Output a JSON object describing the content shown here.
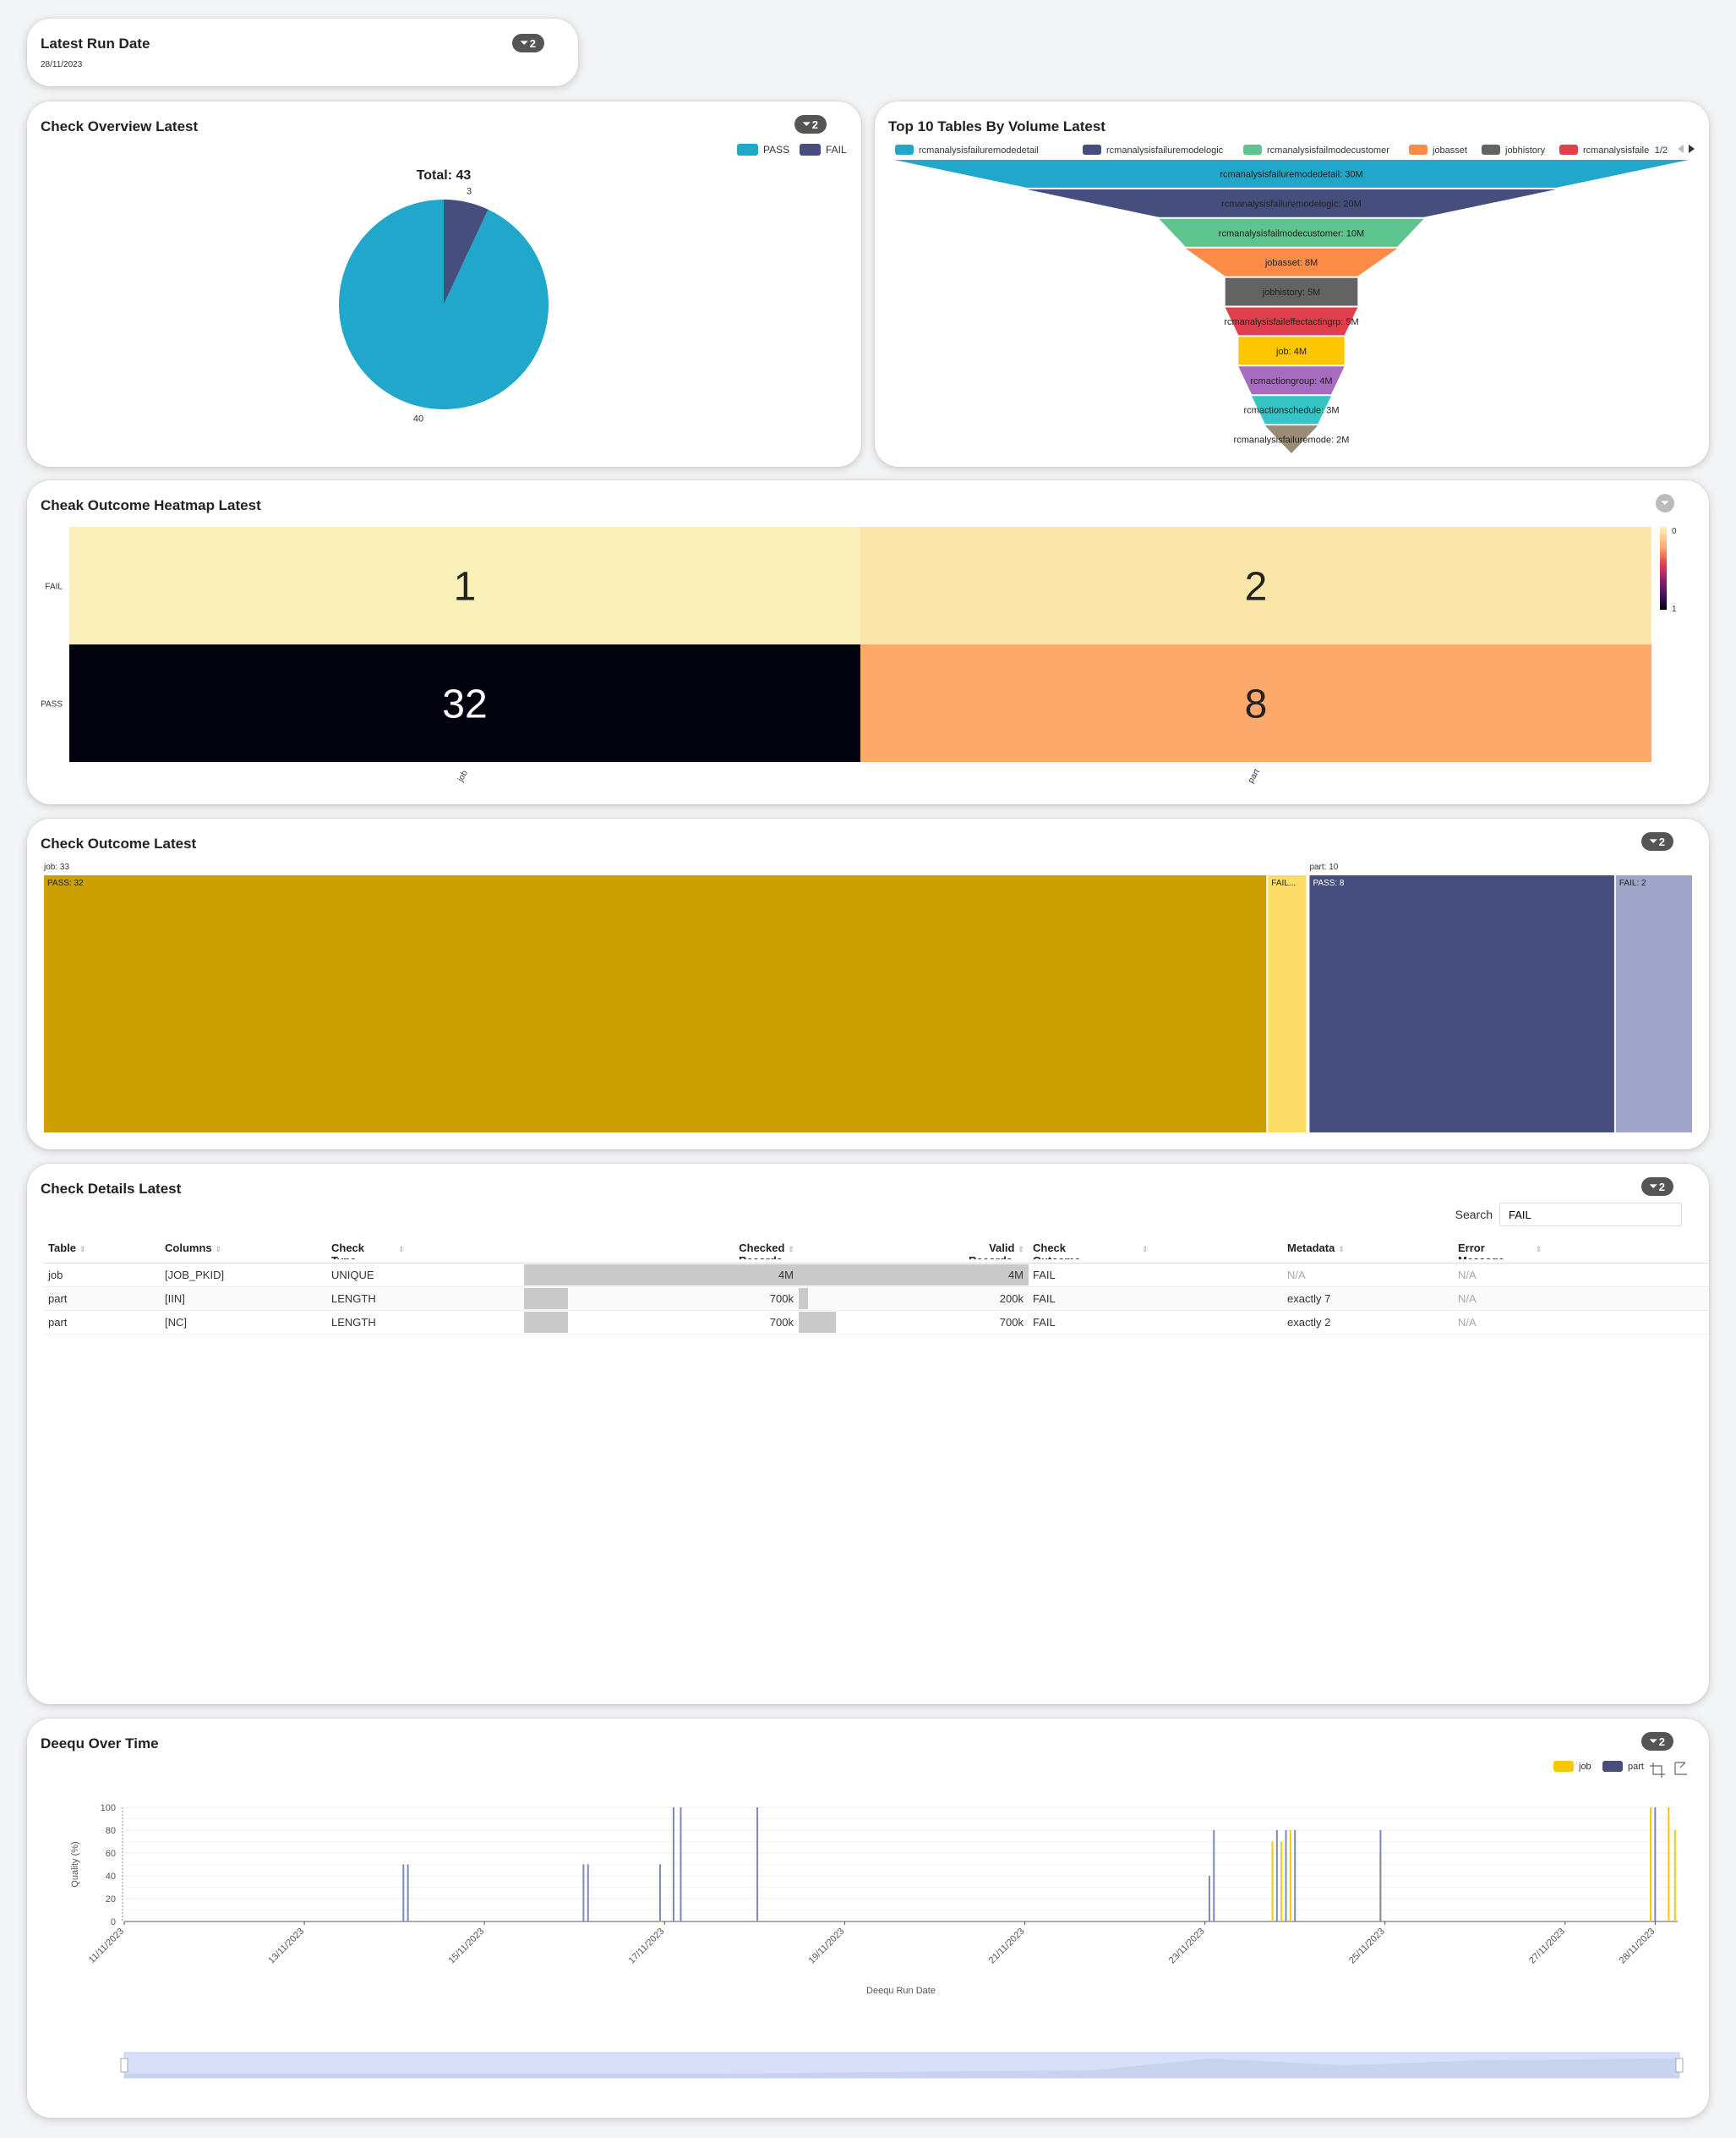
{
  "colors": {
    "pass": "#20a7c9",
    "fail": "#454e7c",
    "job": "#fcc700",
    "part": "#454e7c"
  },
  "latest_run": {
    "title": "Latest Run Date",
    "date": "28/11/2023",
    "filter_count": "2"
  },
  "overview": {
    "title": "Check Overview Latest",
    "filter_count": "2",
    "legend": [
      "PASS",
      "FAIL"
    ],
    "total_label": "Total: 43"
  },
  "funnel": {
    "title": "Top 10 Tables By Volume Latest",
    "legend": [
      "rcmanalysisfailuremodedetail",
      "rcmanalysisfailuremodelogic",
      "rcmanalysisfailmodecustomer",
      "jobasset",
      "jobhistory",
      "rcmanalysisfaile"
    ],
    "legend_page": "1/2"
  },
  "heatmap": {
    "title": "Cheak Outcome Heatmap Latest",
    "scale_max_label": "0",
    "scale_min_label": "1"
  },
  "treemap": {
    "title": "Check Outcome Latest",
    "filter_count": "2"
  },
  "details": {
    "title": "Check Details Latest",
    "filter_count": "2",
    "search_label": "Search",
    "search_value": "FAIL",
    "headers": [
      {
        "label": "Table",
        "sub": ""
      },
      {
        "label": "Columns",
        "sub": ""
      },
      {
        "label": "Check",
        "sub": "Type"
      },
      {
        "label": "Checked",
        "sub": "Records"
      },
      {
        "label": "Valid",
        "sub": "Records"
      },
      {
        "label": "Check",
        "sub": "Outcome"
      },
      {
        "label": "Metadata",
        "sub": ""
      },
      {
        "label": "Error",
        "sub": "Message"
      }
    ],
    "rows": [
      {
        "table": "job",
        "columns": "[JOB_PKID]",
        "type": "UNIQUE",
        "checked": "4M",
        "checked_frac": 1.0,
        "valid": "4M",
        "valid_frac": 1.0,
        "outcome": "FAIL",
        "metadata": "N/A",
        "error": "N/A"
      },
      {
        "table": "part",
        "columns": "[IIN]",
        "type": "LENGTH",
        "checked": "700k",
        "checked_frac": 0.16,
        "valid": "200k",
        "valid_frac": 0.04,
        "outcome": "FAIL",
        "metadata": "exactly 7",
        "error": "N/A"
      },
      {
        "table": "part",
        "columns": "[NC]",
        "type": "LENGTH",
        "checked": "700k",
        "checked_frac": 0.16,
        "valid": "700k",
        "valid_frac": 0.16,
        "outcome": "FAIL",
        "metadata": "exactly 2",
        "error": "N/A"
      }
    ]
  },
  "deequ": {
    "title": "Deequ Over Time",
    "filter_count": "2",
    "legend": [
      "job",
      "part"
    ]
  },
  "chart_data": [
    {
      "type": "pie",
      "title": "Total: 43",
      "categories": [
        "PASS",
        "FAIL"
      ],
      "values": [
        40,
        3
      ],
      "legend": "top-right"
    },
    {
      "type": "funnel",
      "categories": [
        "rcmanalysisfailuremodedetail",
        "rcmanalysisfailuremodelogic",
        "rcmanalysisfailmodecustomer",
        "jobasset",
        "jobhistory",
        "rcmanalysisfaileffectactingrp",
        "job",
        "rcmactiongroup",
        "rcmactionschedule",
        "rcmanalysisfailuremode"
      ],
      "values": [
        30,
        20,
        10,
        8,
        5,
        5,
        4,
        4,
        3,
        2
      ],
      "labels": [
        "rcmanalysisfailuremodedetail: 30M",
        "rcmanalysisfailuremodelogic: 20M",
        "rcmanalysisfailmodecustomer: 10M",
        "jobasset: 8M",
        "jobhistory: 5M",
        "rcmanalysisfaileffectactingrp: 5M",
        "job: 4M",
        "rcmactiongroup: 4M",
        "rcmactionschedule: 3M",
        "rcmanalysisfailuremode: 2M"
      ],
      "colors": [
        "#20a7c9",
        "#454e7c",
        "#5dc48f",
        "#fc8b47",
        "#636363",
        "#e0404e",
        "#fcc700",
        "#a76bc1",
        "#38c4c6",
        "#9c8b76"
      ],
      "legend": "top"
    },
    {
      "type": "heatmap",
      "x": [
        "job",
        "part"
      ],
      "y": [
        "FAIL",
        "PASS"
      ],
      "values": [
        [
          1,
          2
        ],
        [
          32,
          8
        ]
      ],
      "cell_colors": [
        [
          "#f9f0b9",
          "#f9e6a8"
        ],
        [
          "#03020f",
          "#fda96b"
        ]
      ]
    },
    {
      "type": "treemap",
      "groups": [
        {
          "name": "job",
          "label": "job: 33",
          "value": 33,
          "children": [
            {
              "name": "PASS",
              "label": "PASS: 32",
              "value": 32,
              "color": "#cca000"
            },
            {
              "name": "FAIL",
              "label": "FAIL...",
              "value": 1,
              "color": "#fddd67"
            }
          ]
        },
        {
          "name": "part",
          "label": "part: 10",
          "value": 10,
          "children": [
            {
              "name": "PASS",
              "label": "PASS: 8",
              "value": 8,
              "color": "#454e7c"
            },
            {
              "name": "FAIL",
              "label": "FAIL: 2",
              "value": 2,
              "color": "#9fa5c8"
            }
          ]
        }
      ]
    },
    {
      "type": "bar",
      "xlabel": "Deequ Run Date",
      "ylabel": "Quality (%)",
      "ylim": [
        0,
        100
      ],
      "yticks": [
        0,
        20,
        40,
        60,
        80,
        100
      ],
      "x_range": [
        "11/11/2023",
        "28/11/2023"
      ],
      "xticks": [
        "11/11/2023",
        "13/11/2023",
        "15/11/2023",
        "17/11/2023",
        "19/11/2023",
        "21/11/2023",
        "23/11/2023",
        "25/11/2023",
        "27/11/2023",
        "28/11/2023"
      ],
      "legend": "top-right",
      "series": [
        {
          "name": "job",
          "points": [
            {
              "day": 16.95,
              "value": 0
            },
            {
              "day": 17.1,
              "value": 20
            },
            {
              "day": 23.75,
              "value": 70
            },
            {
              "day": 23.85,
              "value": 70
            },
            {
              "day": 23.95,
              "value": 80
            },
            {
              "day": 24.95,
              "value": 60
            },
            {
              "day": 27.95,
              "value": 100
            },
            {
              "day": 28.15,
              "value": 100
            },
            {
              "day": 28.22,
              "value": 80
            }
          ]
        },
        {
          "name": "part",
          "points": [
            {
              "day": 14.1,
              "value": 50
            },
            {
              "day": 14.15,
              "value": 50
            },
            {
              "day": 16.1,
              "value": 50
            },
            {
              "day": 16.15,
              "value": 50
            },
            {
              "day": 16.95,
              "value": 50
            },
            {
              "day": 17.1,
              "value": 100
            },
            {
              "day": 17.18,
              "value": 100
            },
            {
              "day": 18.03,
              "value": 100
            },
            {
              "day": 23.05,
              "value": 40
            },
            {
              "day": 23.1,
              "value": 80
            },
            {
              "day": 23.8,
              "value": 80
            },
            {
              "day": 23.9,
              "value": 80
            },
            {
              "day": 24.0,
              "value": 80
            },
            {
              "day": 24.95,
              "value": 80
            },
            {
              "day": 28.0,
              "value": 100
            }
          ]
        }
      ]
    }
  ]
}
